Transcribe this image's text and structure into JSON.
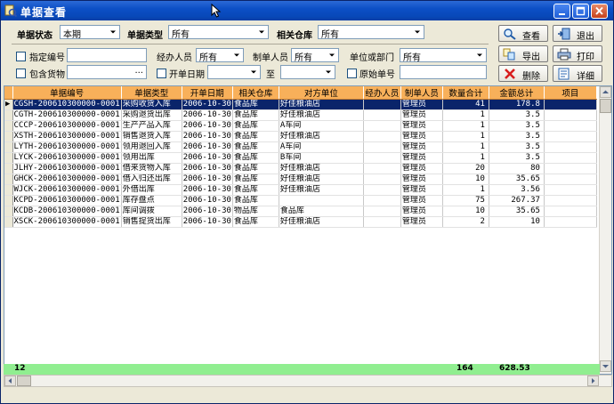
{
  "window": {
    "title": "单据查看"
  },
  "filters": {
    "doc_status_label": "单据状态",
    "doc_status_value": "本期",
    "doc_type_label": "单据类型",
    "doc_type_value": "所有",
    "warehouse_label": "相关仓库",
    "warehouse_value": "所有",
    "specify_no_label": "指定编号",
    "handler_label": "经办人员",
    "handler_value": "所有",
    "maker_label": "制单人员",
    "maker_value": "所有",
    "unit_label": "单位或部门",
    "unit_value": "所有",
    "include_goods_label": "包含货物",
    "date_label": "开单日期",
    "date_to_label": "至",
    "original_no_label": "原始单号",
    "ellipsis": "..."
  },
  "buttons": {
    "view": "查看",
    "exit": "退出",
    "export": "导出",
    "print": "打印",
    "delete": "删除",
    "detail": "详细"
  },
  "table": {
    "columns": [
      "单据编号",
      "单据类型",
      "开单日期",
      "相关仓库",
      "对方单位",
      "经办人员",
      "制单人员",
      "数量合计",
      "金额总计",
      "项目"
    ],
    "rows": [
      [
        "CGSH-200610300000-0001",
        "采购收货入库",
        "2006-10-30",
        "食品库",
        "好佳粮油店",
        "",
        "管理员",
        "41",
        "178.8",
        ""
      ],
      [
        "CGTH-200610300000-0001",
        "采购退货出库",
        "2006-10-30",
        "食品库",
        "好佳粮油店",
        "",
        "管理员",
        "1",
        "3.5",
        ""
      ],
      [
        "CCCP-200610300000-0001",
        "生产产品入库",
        "2006-10-30",
        "食品库",
        "A车间",
        "",
        "管理员",
        "1",
        "3.5",
        ""
      ],
      [
        "XSTH-200610300000-0001",
        "销售退货入库",
        "2006-10-30",
        "食品库",
        "好佳粮油店",
        "",
        "管理员",
        "1",
        "3.5",
        ""
      ],
      [
        "LYTH-200610300000-0001",
        "领用退回入库",
        "2006-10-30",
        "食品库",
        "A车间",
        "",
        "管理员",
        "1",
        "3.5",
        ""
      ],
      [
        "LYCK-200610300000-0001",
        "领用出库",
        "2006-10-30",
        "食品库",
        "B车间",
        "",
        "管理员",
        "1",
        "3.5",
        ""
      ],
      [
        "JLHY-200610300000-0001",
        "借来货物入库",
        "2006-10-30",
        "食品库",
        "好佳粮油店",
        "",
        "管理员",
        "20",
        "80",
        ""
      ],
      [
        "GHCK-200610300000-0001",
        "借入归还出库",
        "2006-10-30",
        "食品库",
        "好佳粮油店",
        "",
        "管理员",
        "10",
        "35.65",
        ""
      ],
      [
        "WJCK-200610300000-0001",
        "外借出库",
        "2006-10-30",
        "食品库",
        "好佳粮油店",
        "",
        "管理员",
        "1",
        "3.56",
        ""
      ],
      [
        "KCPD-200610300000-0001",
        "库存盘点",
        "2006-10-30",
        "食品库",
        "",
        "",
        "管理员",
        "75",
        "267.37",
        ""
      ],
      [
        "KCDB-200610300000-0001",
        "库间调拨",
        "2006-10-30",
        "物品库",
        "食品库",
        "",
        "管理员",
        "10",
        "35.65",
        ""
      ],
      [
        "XSCK-200610300000-0001",
        "销售提货出库",
        "2006-10-30",
        "食品库",
        "好佳粮油店",
        "",
        "管理员",
        "2",
        "10",
        ""
      ]
    ]
  },
  "footer": {
    "count": "12",
    "qty_total": "164",
    "amount_total": "628.53"
  }
}
